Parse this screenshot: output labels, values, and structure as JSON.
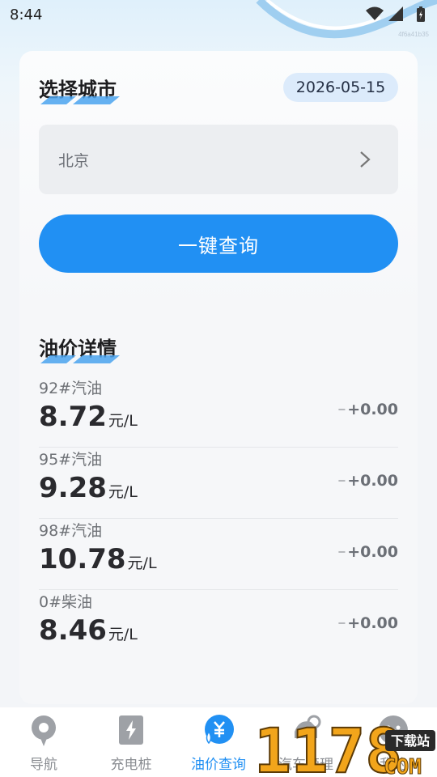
{
  "status_bar": {
    "time": "8:44",
    "tag": "4f6a41b35"
  },
  "city_section": {
    "title": "选择城市",
    "date": "2026-05-15",
    "city_value": "北京",
    "query_button": "一键查询"
  },
  "price_section": {
    "title": "油价详情",
    "items": [
      {
        "name": "92#汽油",
        "price": "8.72",
        "unit": "元/L",
        "dash": "--",
        "change": "+0.00"
      },
      {
        "name": "95#汽油",
        "price": "9.28",
        "unit": "元/L",
        "dash": "--",
        "change": "+0.00"
      },
      {
        "name": "98#汽油",
        "price": "10.78",
        "unit": "元/L",
        "dash": "--",
        "change": "+0.00"
      },
      {
        "name": "0#柴油",
        "price": "8.46",
        "unit": "元/L",
        "dash": "--",
        "change": "+0.00"
      }
    ]
  },
  "tab_bar": {
    "tabs": [
      {
        "label": "导航",
        "icon": "location-pin-icon"
      },
      {
        "label": "充电桩",
        "icon": "charging-station-icon"
      },
      {
        "label": "油价查询",
        "icon": "oil-price-icon"
      },
      {
        "label": "汽车管理",
        "icon": "car-wrench-icon"
      },
      {
        "label": "我的",
        "icon": "profile-icon"
      }
    ]
  },
  "watermark": {
    "brand": "1178",
    "sub": "下载站",
    "domain": "COM"
  },
  "colors": {
    "accent": "#2190f3",
    "pill": "#dcebfb",
    "underline": "#4aa3ef"
  }
}
